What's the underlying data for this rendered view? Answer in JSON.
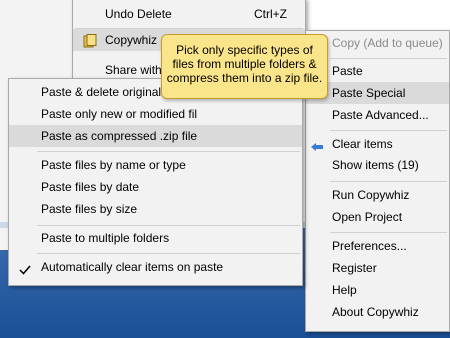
{
  "top_menu": {
    "undo_label": "Undo Delete",
    "undo_shortcut": "Ctrl+Z",
    "copywhiz_label": "Copywhiz",
    "share_label": "Share with"
  },
  "right_menu": {
    "items": [
      {
        "label": "Copy (Add to queue)",
        "state": "disabled"
      },
      {
        "label": "Paste"
      },
      {
        "label": "Paste Special",
        "state": "highlighted"
      },
      {
        "label": "Paste Advanced..."
      },
      {
        "label": "Clear items"
      },
      {
        "label": "Show items (19)"
      },
      {
        "label": "Run Copywhiz"
      },
      {
        "label": "Open Project"
      },
      {
        "label": "Preferences..."
      },
      {
        "label": "Register"
      },
      {
        "label": "Help"
      },
      {
        "label": "About Copywhiz"
      }
    ]
  },
  "submenu": {
    "items": [
      {
        "label": "Paste & delete original f"
      },
      {
        "label": "Paste only new or modified fil"
      },
      {
        "label": "Paste as compressed .zip file",
        "state": "highlighted"
      },
      {
        "label": "Paste files by name or type"
      },
      {
        "label": "Paste files by date"
      },
      {
        "label": "Paste files by size"
      },
      {
        "label": "Paste to multiple folders"
      },
      {
        "label": "Automatically clear items on paste",
        "checked": true
      }
    ]
  },
  "tooltip": {
    "line1": "Pick only specific types of",
    "line2": "files from multiple folders &",
    "line3": "compress them into a zip file."
  },
  "colors": {
    "tooltip_bg": "#fbe58a",
    "highlight": "#dadada",
    "menu_bg": "#f2f2f2"
  }
}
